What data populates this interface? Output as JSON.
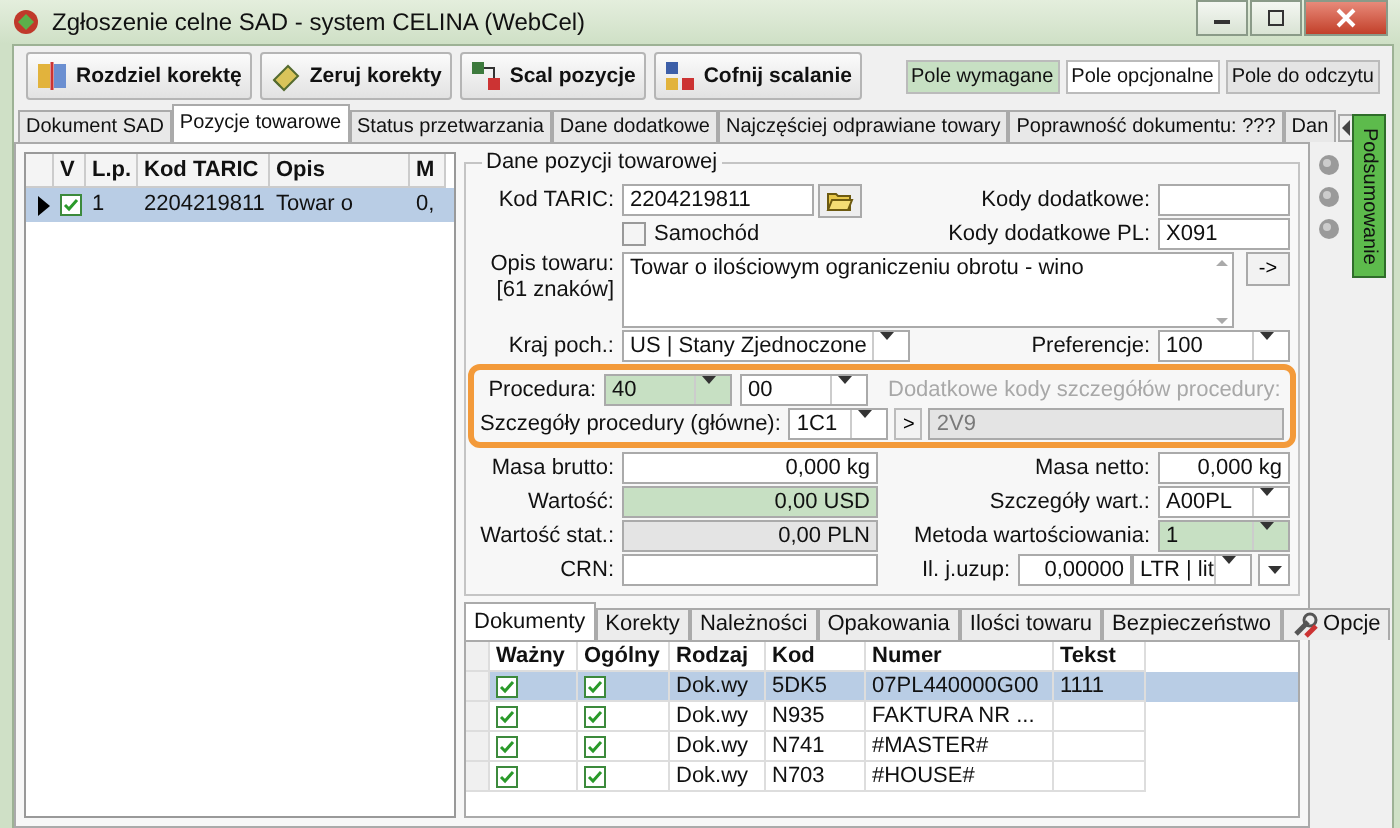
{
  "window": {
    "title": "Zgłoszenie celne SAD - system CELINA (WebCel)"
  },
  "toolbar": [
    {
      "label": "Rozdziel korektę",
      "kind": "split"
    },
    {
      "label": "Zeruj korekty",
      "kind": "reset"
    },
    {
      "label": "Scal pozycje",
      "kind": "merge"
    },
    {
      "label": "Cofnij scalanie",
      "kind": "unmerge"
    }
  ],
  "legend": [
    {
      "label": "Pole wymagane",
      "kind": "required"
    },
    {
      "label": "Pole opcjonalne",
      "kind": "optional"
    },
    {
      "label": "Pole do odczytu",
      "kind": "readonly"
    }
  ],
  "tabs": [
    {
      "label": "Dokument SAD",
      "selected": false
    },
    {
      "label": "Pozycje towarowe",
      "selected": true
    },
    {
      "label": "Status przetwarzania",
      "selected": false
    },
    {
      "label": "Dane dodatkowe",
      "selected": false
    },
    {
      "label": "Najczęściej odprawiane towary",
      "selected": false
    },
    {
      "label": "Poprawność dokumentu: ???",
      "selected": false
    },
    {
      "label": "Dan",
      "selected": false
    }
  ],
  "positions_table": {
    "columns": [
      "V",
      "L.p.",
      "Kod TARIC",
      "Opis",
      "M"
    ],
    "rows": [
      {
        "selected": true,
        "checked": true,
        "cells": [
          "",
          "1",
          "2204219811",
          "Towar o",
          "0,"
        ]
      }
    ]
  },
  "position_form": {
    "title": "Dane pozycji towarowej",
    "kod_taric": {
      "label": "Kod TARIC:",
      "value": "2204219811",
      "kind": "optional"
    },
    "kody_dodatkowe": {
      "label": "Kody dodatkowe:",
      "kind": "optional"
    },
    "samochod": {
      "label": "Samochód",
      "checked": false
    },
    "kody_dodatkowe_pl": {
      "label": "Kody dodatkowe PL:",
      "value": "X091",
      "kind": "optional"
    },
    "opis": {
      "label": "Opis towaru:",
      "count": "[61 znaków]",
      "value": "Towar o ilościowym ograniczeniu obrotu - wino",
      "button": "->",
      "kind": "optional"
    },
    "kraj": {
      "label": "Kraj poch.:",
      "value": "US | Stany Zjednoczone",
      "kind": "optional"
    },
    "preferencje": {
      "label": "Preferencje:",
      "value": "100",
      "kind": "optional"
    },
    "procedura": {
      "label": "Procedura:",
      "fields": [
        {
          "value": "40",
          "kind": "required"
        },
        {
          "value": "00",
          "kind": "optional"
        }
      ]
    },
    "dodatkowe_kody": {
      "label": "Dodatkowe kody szczegółów procedury:",
      "disabled": true,
      "value": "2V9",
      "kind": "readonly"
    },
    "szczegoly_procedury": {
      "label": "Szczegóły procedury (główne):",
      "value": "1C1",
      "button": ">",
      "kind": "optional"
    },
    "masa_brutto": {
      "label": "Masa brutto:",
      "value": "0,000 kg",
      "kind": "optional"
    },
    "masa_netto": {
      "label": "Masa netto:",
      "value": "0,000 kg",
      "kind": "optional"
    },
    "wartosc": {
      "label": "Wartość:",
      "value": "0,00 USD",
      "kind": "required"
    },
    "szczegoly_wart": {
      "label": "Szczegóły wart.:",
      "value": "A00PL",
      "kind": "optional"
    },
    "wartosc_stat": {
      "label": "Wartość stat.:",
      "value": "0,00 PLN",
      "kind": "readonly"
    },
    "metoda": {
      "label": "Metoda wartościowania:",
      "value": "1",
      "kind": "required"
    },
    "crn": {
      "label": "CRN:",
      "kind": "optional"
    },
    "il_uzup": {
      "label": "Il. j.uzup:",
      "value": "0,00000",
      "unit": "LTR | lit",
      "kind": "optional"
    }
  },
  "document_tabs": [
    {
      "label": "Dokumenty",
      "selected": true
    },
    {
      "label": "Korekty",
      "selected": false
    },
    {
      "label": "Należności",
      "selected": false
    },
    {
      "label": "Opakowania",
      "selected": false
    },
    {
      "label": "Ilości towaru",
      "selected": false
    },
    {
      "label": "Bezpieczeństwo",
      "selected": false
    },
    {
      "label": "Opcje",
      "selected": false,
      "kind": "tools"
    }
  ],
  "documents_table": {
    "columns": [
      "Ważny",
      "Ogólny",
      "Rodzaj",
      "Kod",
      "Numer",
      "Tekst"
    ],
    "rows": [
      {
        "selected": true,
        "valid": true,
        "general": true,
        "rodzaj": "Dok.wy",
        "kod": "5DK5",
        "numer": "07PL440000G00",
        "tekst": "1111"
      },
      {
        "selected": false,
        "valid": true,
        "general": true,
        "rodzaj": "Dok.wy",
        "kod": "N935",
        "numer": "FAKTURA NR ..."
      },
      {
        "selected": false,
        "valid": true,
        "general": true,
        "rodzaj": "Dok.wy",
        "kod": "N741",
        "numer": "#MASTER#"
      },
      {
        "selected": false,
        "valid": true,
        "general": true,
        "rodzaj": "Dok.wy",
        "kod": "N703",
        "numer": "#HOUSE#"
      }
    ]
  },
  "side_tab": {
    "label": "Podsumowanie"
  }
}
